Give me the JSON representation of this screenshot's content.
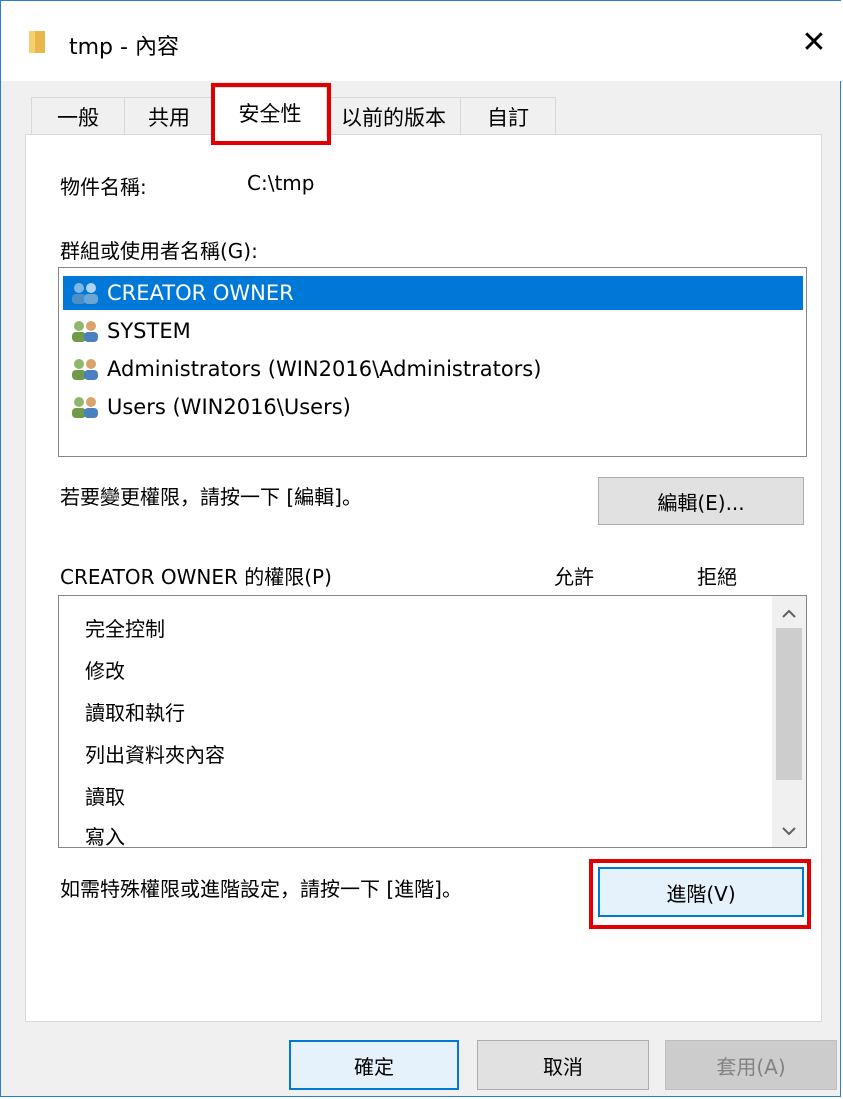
{
  "window": {
    "title": "tmp - 內容",
    "close_label": "✕"
  },
  "tabs": [
    {
      "label": "一般"
    },
    {
      "label": "共用"
    },
    {
      "label": "安全性"
    },
    {
      "label": "以前的版本"
    },
    {
      "label": "自訂"
    }
  ],
  "active_tab": "安全性",
  "object_name": {
    "label": "物件名稱:",
    "value": "C:\\tmp"
  },
  "groups": {
    "label": "群組或使用者名稱(G):",
    "items": [
      {
        "name": "CREATOR OWNER",
        "selected": true
      },
      {
        "name": "SYSTEM",
        "selected": false
      },
      {
        "name": "Administrators (WIN2016\\Administrators)",
        "selected": false
      },
      {
        "name": "Users (WIN2016\\Users)",
        "selected": false
      }
    ]
  },
  "edit": {
    "hint": "若要變更權限，請按一下 [編輯]。",
    "button": "編輯(E)..."
  },
  "permissions": {
    "header": "CREATOR OWNER 的權限(P)",
    "allow_header": "允許",
    "deny_header": "拒絕",
    "items": [
      "完全控制",
      "修改",
      "讀取和執行",
      "列出資料夾內容",
      "讀取",
      "寫入"
    ]
  },
  "advanced": {
    "hint": "如需特殊權限或進階設定，請按一下 [進階]。",
    "button": "進階(V)"
  },
  "footer": {
    "ok": "確定",
    "cancel": "取消",
    "apply": "套用(A)"
  },
  "colors": {
    "selection": "#0078d7",
    "highlight_box": "#e00000",
    "window_border": "#2b7cd3"
  }
}
